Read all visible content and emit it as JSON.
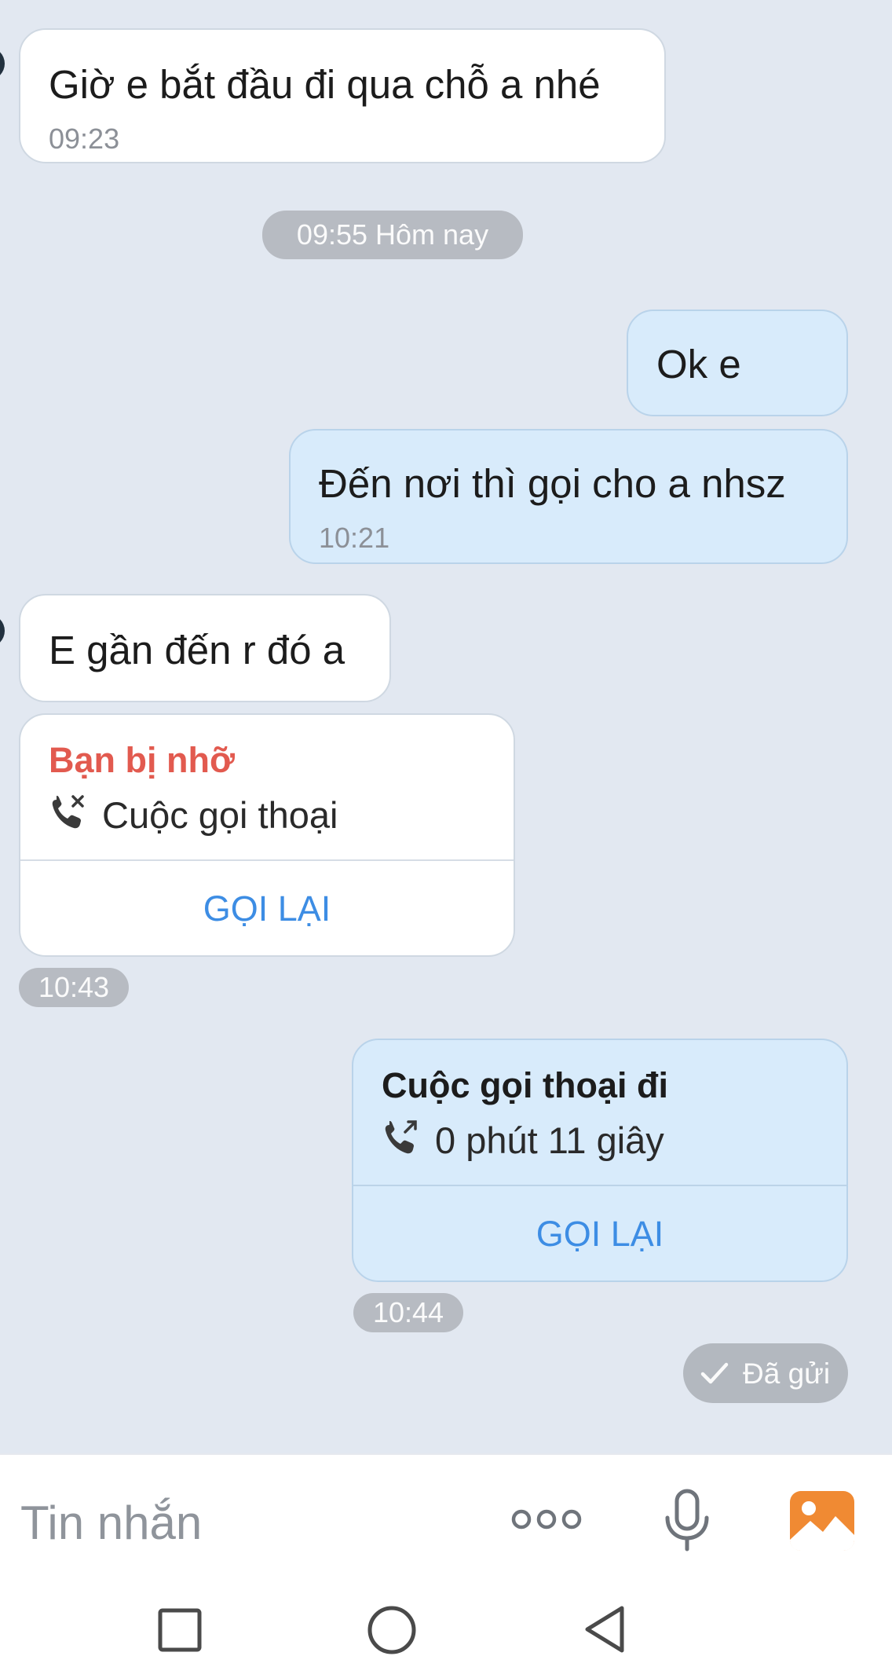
{
  "messages": {
    "m1": {
      "text": "Giờ e bắt đầu đi qua chỗ a nhé",
      "time": "09:23"
    },
    "m2": {
      "text": "Ok e"
    },
    "m3": {
      "text": "Đến nơi thì gọi cho a nhsz",
      "time": "10:21"
    },
    "m4": {
      "text": "E gần đến r đó a"
    }
  },
  "date_separator": "09:55 Hôm nay",
  "missed_call": {
    "title": "Bạn bị nhỡ",
    "subtitle": "Cuộc gọi thoại",
    "action": "GỌI LẠI",
    "time": "10:43",
    "icon": "missed-call-icon"
  },
  "outgoing_call": {
    "title": "Cuộc gọi thoại đi",
    "subtitle": "0 phút 11 giây",
    "action": "GỌI LẠI",
    "time": "10:44",
    "icon": "outgoing-call-icon"
  },
  "status": {
    "label": "Đã gửi",
    "icon": "check-icon"
  },
  "composer": {
    "placeholder": "Tin nhắn",
    "icons": [
      "more-icon",
      "microphone-icon",
      "image-icon"
    ]
  },
  "navigation": {
    "icons": [
      "recent-apps-icon",
      "home-icon",
      "back-icon"
    ]
  },
  "colors": {
    "chat_bg": "#e2e8f1",
    "outgoing_bubble": "#d8ebfb",
    "incoming_bubble": "#ffffff",
    "accent_blue": "#3d8de4",
    "missed_red": "#e25a4f",
    "image_icon_orange": "#f08a33"
  }
}
